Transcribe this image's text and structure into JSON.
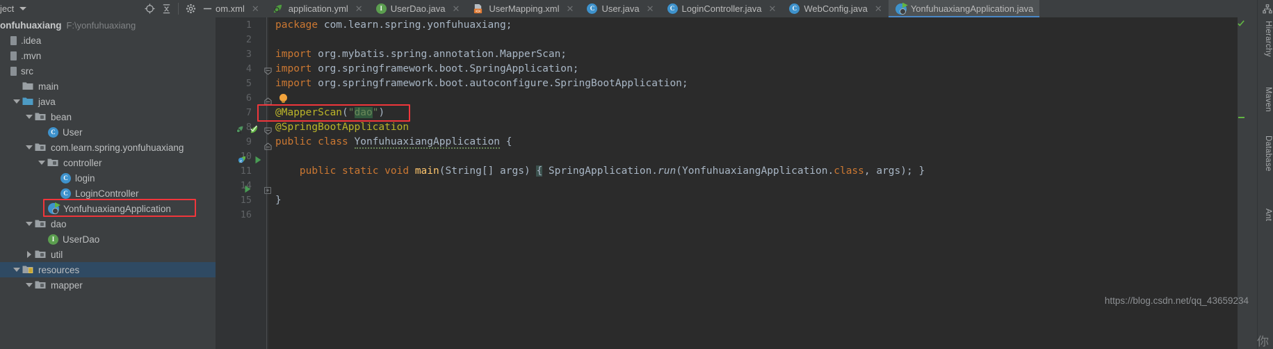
{
  "window": {
    "project_panel_label": "ject",
    "project_name": "onfuhuaxiang",
    "project_path": "F:\\yonfuhuaxiang"
  },
  "project_toolbar": {
    "icons": [
      "locate-icon",
      "collapse-all-icon",
      "settings-gear-icon",
      "hide-icon"
    ]
  },
  "sidebar": {
    "items": [
      {
        "label": ".idea",
        "indent": 0,
        "icon": "flat-folder-icon",
        "arrow": "none",
        "selected": false
      },
      {
        "label": ".mvn",
        "indent": 0,
        "icon": "flat-folder-icon",
        "arrow": "none",
        "selected": false
      },
      {
        "label": "src",
        "indent": 0,
        "icon": "flat-folder-icon",
        "arrow": "none",
        "selected": false
      },
      {
        "label": "main",
        "indent": 1,
        "icon": "folder-icon",
        "arrow": "none",
        "selected": false
      },
      {
        "label": "java",
        "indent": 1,
        "icon": "source-folder-icon",
        "arrow": "expanded",
        "selected": false
      },
      {
        "label": "bean",
        "indent": 2,
        "icon": "package-icon",
        "arrow": "expanded",
        "selected": false
      },
      {
        "label": "User",
        "indent": 3,
        "icon": "class-icon",
        "arrow": "none",
        "selected": false
      },
      {
        "label": "com.learn.spring.yonfuhuaxiang",
        "indent": 2,
        "icon": "package-icon",
        "arrow": "expanded",
        "selected": false
      },
      {
        "label": "controller",
        "indent": 3,
        "icon": "package-icon",
        "arrow": "expanded",
        "selected": false
      },
      {
        "label": "login",
        "indent": 4,
        "icon": "class-icon",
        "arrow": "none",
        "selected": false
      },
      {
        "label": "LoginController",
        "indent": 4,
        "icon": "class-icon",
        "arrow": "none",
        "selected": false
      },
      {
        "label": "YonfuhuaxiangApplication",
        "indent": 3,
        "icon": "spring-boot-class-icon",
        "arrow": "none",
        "selected": false,
        "highlighted": true
      },
      {
        "label": "dao",
        "indent": 2,
        "icon": "package-icon",
        "arrow": "expanded",
        "selected": false
      },
      {
        "label": "UserDao",
        "indent": 3,
        "icon": "interface-icon",
        "arrow": "none",
        "selected": false
      },
      {
        "label": "util",
        "indent": 2,
        "icon": "package-icon",
        "arrow": "collapsed",
        "selected": false
      },
      {
        "label": "resources",
        "indent": 1,
        "icon": "resources-folder-icon",
        "arrow": "expanded",
        "selected": true
      },
      {
        "label": "mapper",
        "indent": 2,
        "icon": "package-icon",
        "arrow": "expanded",
        "selected": false
      }
    ]
  },
  "tabs": {
    "items": [
      {
        "label": "om.xml",
        "icon": "maven-xml-icon",
        "active": false,
        "clipped": true
      },
      {
        "label": "application.yml",
        "icon": "spring-leaf-icon",
        "active": false
      },
      {
        "label": "UserDao.java",
        "icon": "interface-icon",
        "active": false
      },
      {
        "label": "UserMapping.xml",
        "icon": "xml-file-icon",
        "active": false
      },
      {
        "label": "User.java",
        "icon": "class-icon",
        "active": false
      },
      {
        "label": "LoginController.java",
        "icon": "class-icon",
        "active": false
      },
      {
        "label": "WebConfig.java",
        "icon": "class-icon",
        "active": false
      },
      {
        "label": "YonfuhuaxiangApplication.java",
        "icon": "spring-boot-class-icon",
        "active": true
      }
    ],
    "close_glyph": "✕",
    "overflow_label": "▾≣"
  },
  "editor": {
    "lines": [
      {
        "num": "1",
        "text": "package com.learn.spring.yonfuhuaxiang;"
      },
      {
        "num": "2",
        "text": ""
      },
      {
        "num": "3",
        "text": "import org.mybatis.spring.annotation.MapperScan;"
      },
      {
        "num": "4",
        "text": "import org.springframework.boot.SpringApplication;"
      },
      {
        "num": "5",
        "text": "import org.springframework.boot.autoconfigure.SpringBootApplication;"
      },
      {
        "num": "6",
        "text": ""
      },
      {
        "num": "7",
        "text": "@MapperScan(\"dao\")"
      },
      {
        "num": "8",
        "text": "@SpringBootApplication"
      },
      {
        "num": "9",
        "text": "public class YonfuhuaxiangApplication {"
      },
      {
        "num": "10",
        "text": ""
      },
      {
        "num": "11",
        "text": "    public static void main(String[] args) { SpringApplication.run(YonfuhuaxiangApplication.class, args); }"
      },
      {
        "num": "14",
        "text": ""
      },
      {
        "num": "15",
        "text": "}"
      },
      {
        "num": "16",
        "text": ""
      }
    ],
    "inspection_status": "ok"
  },
  "tool_windows": {
    "right": [
      "Hierarchy",
      "Maven",
      "Database",
      "Ant"
    ]
  },
  "watermark": "https://blog.csdn.net/qq_43659234",
  "corner_text": "你",
  "colors": {
    "accent": "#4a88c7",
    "highlight_box": "#f0363b",
    "selection": "#2f4a63",
    "editor_bg": "#2b2b2b",
    "panel_bg": "#3c3f41",
    "keyword": "#cc7832",
    "annotation": "#bbb529",
    "string": "#6a8759",
    "text": "#a9b7c6"
  }
}
